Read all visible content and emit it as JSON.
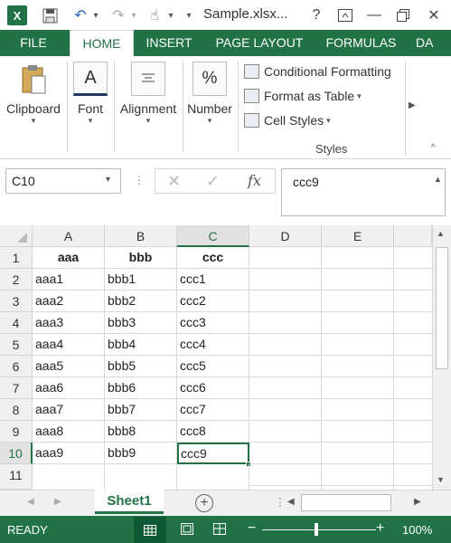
{
  "app": {
    "filename": "Sample.xlsx..."
  },
  "tabs": [
    {
      "label": "FILE"
    },
    {
      "label": "HOME"
    },
    {
      "label": "INSERT"
    },
    {
      "label": "PAGE LAYOUT"
    },
    {
      "label": "FORMULAS"
    },
    {
      "label": "DA"
    }
  ],
  "ribbon": {
    "clipboard": "Clipboard",
    "font": "Font",
    "alignment": "Alignment",
    "number": "Number",
    "font_glyph": "A",
    "number_glyph": "%",
    "styles_items": [
      "Conditional Formatting",
      "Format as Table",
      "Cell Styles"
    ],
    "styles_group": "Styles"
  },
  "formula_bar": {
    "name_box": "C10",
    "fx": "fx",
    "value": "ccc9"
  },
  "grid": {
    "columns": [
      "A",
      "B",
      "C",
      "D",
      "E"
    ],
    "rows": [
      "1",
      "2",
      "3",
      "4",
      "5",
      "6",
      "7",
      "8",
      "9",
      "10",
      "11"
    ],
    "cells": [
      [
        "aaa",
        "bbb",
        "ccc"
      ],
      [
        "aaa1",
        "bbb1",
        "ccc1"
      ],
      [
        "aaa2",
        "bbb2",
        "ccc2"
      ],
      [
        "aaa3",
        "bbb3",
        "ccc3"
      ],
      [
        "aaa4",
        "bbb4",
        "ccc4"
      ],
      [
        "aaa5",
        "bbb5",
        "ccc5"
      ],
      [
        "aaa6",
        "bbb6",
        "ccc6"
      ],
      [
        "aaa7",
        "bbb7",
        "ccc7"
      ],
      [
        "aaa8",
        "bbb8",
        "ccc8"
      ],
      [
        "aaa9",
        "bbb9",
        "ccc9"
      ],
      [
        "",
        "",
        ""
      ]
    ],
    "active_cell": "C10"
  },
  "sheets": [
    {
      "label": "Sheet1"
    }
  ],
  "status": {
    "ready": "READY",
    "zoom": "100%"
  },
  "colors": {
    "accent": "#217346"
  }
}
